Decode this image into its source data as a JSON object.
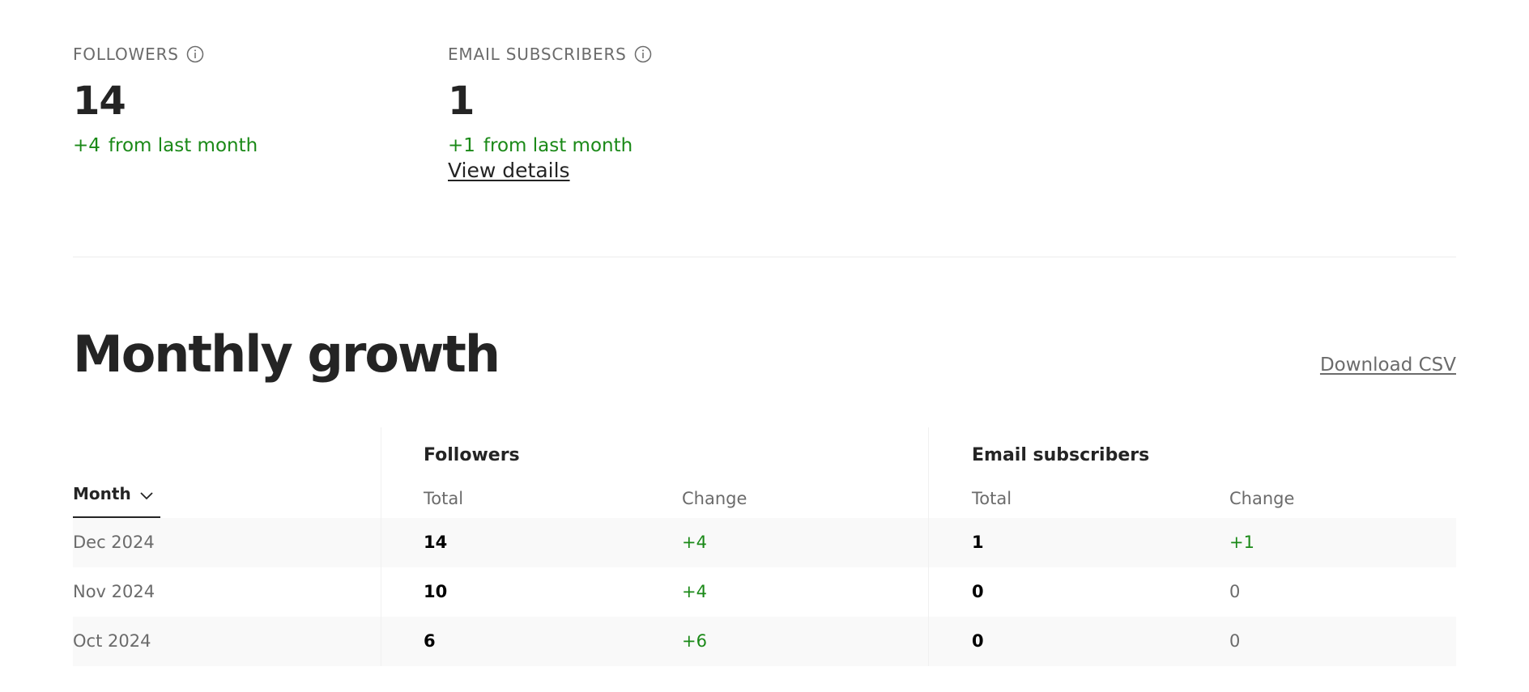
{
  "stats": {
    "followers": {
      "label": "FOLLOWERS",
      "value": "14",
      "delta": "+4",
      "suffix": "from last month"
    },
    "email": {
      "label": "EMAIL SUBSCRIBERS",
      "value": "1",
      "delta": "+1",
      "suffix": "from last month",
      "link": "View details"
    }
  },
  "growth": {
    "title": "Monthly growth",
    "download_label": "Download CSV",
    "month_header": "Month",
    "groups": {
      "followers": "Followers",
      "email": "Email subscribers"
    },
    "sub_headers": {
      "total": "Total",
      "change": "Change"
    },
    "rows": [
      {
        "month": "Dec 2024",
        "f_total": "14",
        "f_change": "+4",
        "e_total": "1",
        "e_change": "+1"
      },
      {
        "month": "Nov 2024",
        "f_total": "10",
        "f_change": "+4",
        "e_total": "0",
        "e_change": "0"
      },
      {
        "month": "Oct 2024",
        "f_total": "6",
        "f_change": "+6",
        "e_total": "0",
        "e_change": "0"
      }
    ]
  },
  "icons": {
    "info": "info-icon",
    "sort": "chevron-down-icon"
  },
  "colors": {
    "positive": "#1a8917",
    "muted": "#6b6b6b",
    "text": "#242424"
  }
}
